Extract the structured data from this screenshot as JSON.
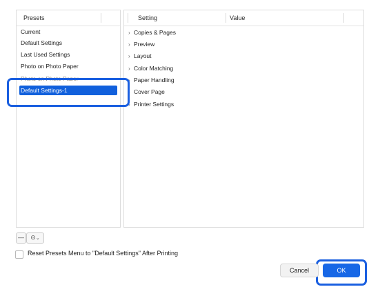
{
  "presets": {
    "header": "Presets",
    "items": [
      "Current",
      "Default Settings",
      "Last Used Settings",
      "Photo on Photo Paper",
      "Photo on Photo Paper",
      "Default Settings-1"
    ],
    "selected_index": 5
  },
  "settings": {
    "header_setting": "Setting",
    "header_value": "Value",
    "rows": [
      "Copies & Pages",
      "Preview",
      "Layout",
      "Color Matching",
      "Paper Handling",
      "Cover Page",
      "Printer Settings"
    ]
  },
  "toolbar": {
    "minus": "—",
    "action": "⊙"
  },
  "checkbox": {
    "label": "Reset Presets Menu to \"Default Settings\" After Printing",
    "checked": false
  },
  "buttons": {
    "cancel": "Cancel",
    "ok": "OK"
  },
  "colors": {
    "accent": "#1767e6",
    "highlight_outline": "#1a5fe0"
  }
}
